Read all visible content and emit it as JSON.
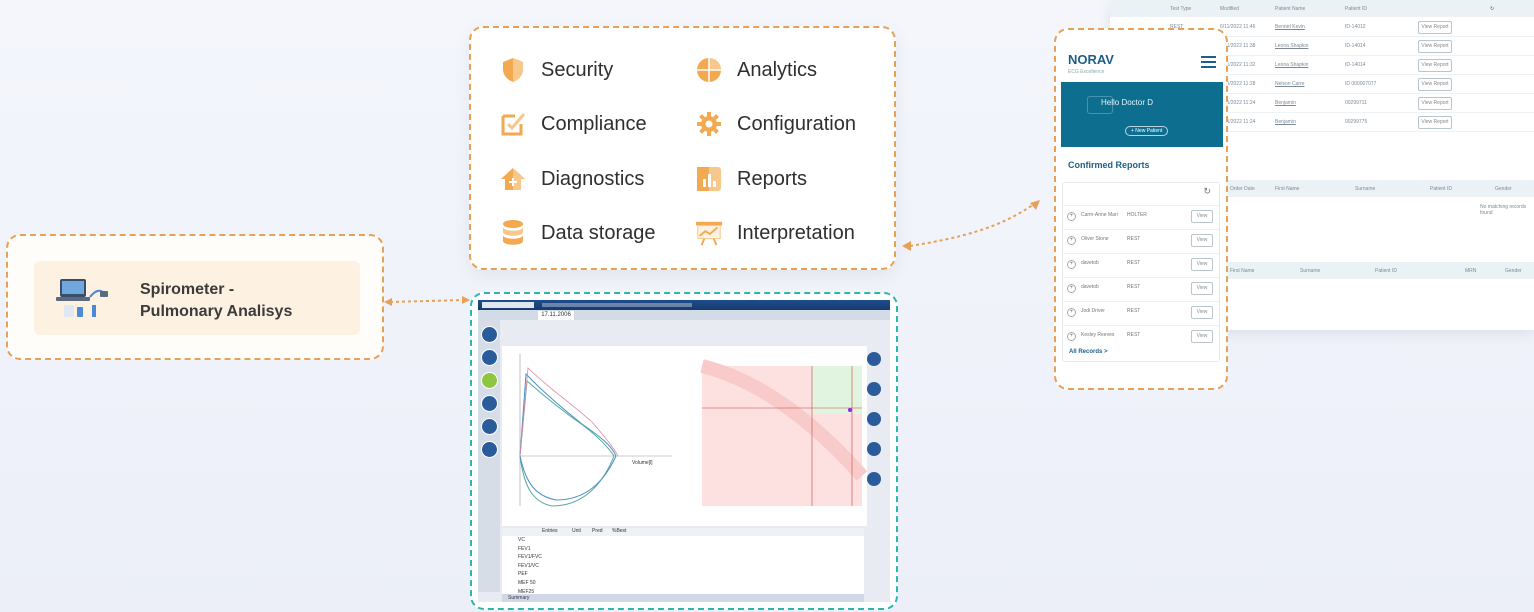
{
  "spirometer": {
    "line1": "Spirometer -",
    "line2": "Pulmonary Analisys"
  },
  "features": [
    {
      "label": "Security",
      "icon": "shield-icon"
    },
    {
      "label": "Analytics",
      "icon": "pie-chart-icon"
    },
    {
      "label": "Compliance",
      "icon": "checkbox-icon"
    },
    {
      "label": "Configuration",
      "icon": "gear-icon"
    },
    {
      "label": "Diagnostics",
      "icon": "medical-house-icon"
    },
    {
      "label": "Reports",
      "icon": "bar-report-icon"
    },
    {
      "label": "Data storage",
      "icon": "database-icon"
    },
    {
      "label": "Interpretation",
      "icon": "presentation-chart-icon"
    }
  ],
  "mobile": {
    "brand": "NORAV",
    "tagline": "ECG Excellence",
    "greeting": "Hello Doctor D",
    "new_patient": "+ New Patient",
    "section_title": "Confirmed Reports",
    "rows": [
      {
        "name": "Carm-Anne Mari",
        "type": "HOLTER",
        "action": "View"
      },
      {
        "name": "Oliver Stone",
        "type": "REST",
        "action": "View"
      },
      {
        "name": "davetob",
        "type": "REST",
        "action": "View"
      },
      {
        "name": "davetob",
        "type": "REST",
        "action": "View"
      },
      {
        "name": "Jodi Driver",
        "type": "REST",
        "action": "View"
      },
      {
        "name": "Kesley Reeves",
        "type": "REST",
        "action": "View"
      }
    ],
    "all_link": "All Records >"
  },
  "desktop": {
    "headers": [
      "Test Type",
      "Modified",
      "Patient Name",
      "Patient ID"
    ],
    "rows": [
      {
        "type": "REST",
        "date": "6/11/2022 11:46",
        "name": "Bennet Kevin",
        "id": "ID-14012",
        "btn": "View Report"
      },
      {
        "type": "",
        "date": "6/11/2022 11:38",
        "name": "Leona Shapkin",
        "id": "ID-14014",
        "btn": "View Report"
      },
      {
        "type": "",
        "date": "6/11/2022 11:32",
        "name": "Leona Shapkin",
        "id": "ID-14014",
        "btn": "View Report"
      },
      {
        "type": "",
        "date": "6/11/2022 11:28",
        "name": "Nelson Carre",
        "id": "ID 000007077",
        "btn": "View Report"
      },
      {
        "type": "",
        "date": "6/11/2022 11:24",
        "name": "Benjamin",
        "id": "00299711",
        "btn": "View Report"
      },
      {
        "type": "",
        "date": "6/11/2022 11:24",
        "name": "Benjamin",
        "id": "00299775",
        "btn": "View Report"
      }
    ],
    "headers2": [
      "Order Date",
      "First Name",
      "Surname",
      "Patient ID",
      "Gender"
    ],
    "no_records": "No matching records found",
    "headers3": [
      "First Name",
      "Surname",
      "Patient ID",
      "MRN",
      "Gender"
    ]
  },
  "software": {
    "date_tab": "17.11.2006",
    "volume_label": "Volume[l]",
    "table_headers": [
      "",
      "Entries",
      "Unit",
      "Pred",
      "%Best",
      "",
      "%Best",
      "",
      "%Best"
    ],
    "table_rows": [
      "VC",
      "FEV1",
      "FEV1/FVC",
      "FEV1/VC",
      "PEF",
      "MEF 50",
      "MEF25"
    ],
    "footer": "Summary"
  },
  "colors": {
    "orange": "#e7a055",
    "teal": "#2bb6ae",
    "navy": "#0e6e8f"
  }
}
